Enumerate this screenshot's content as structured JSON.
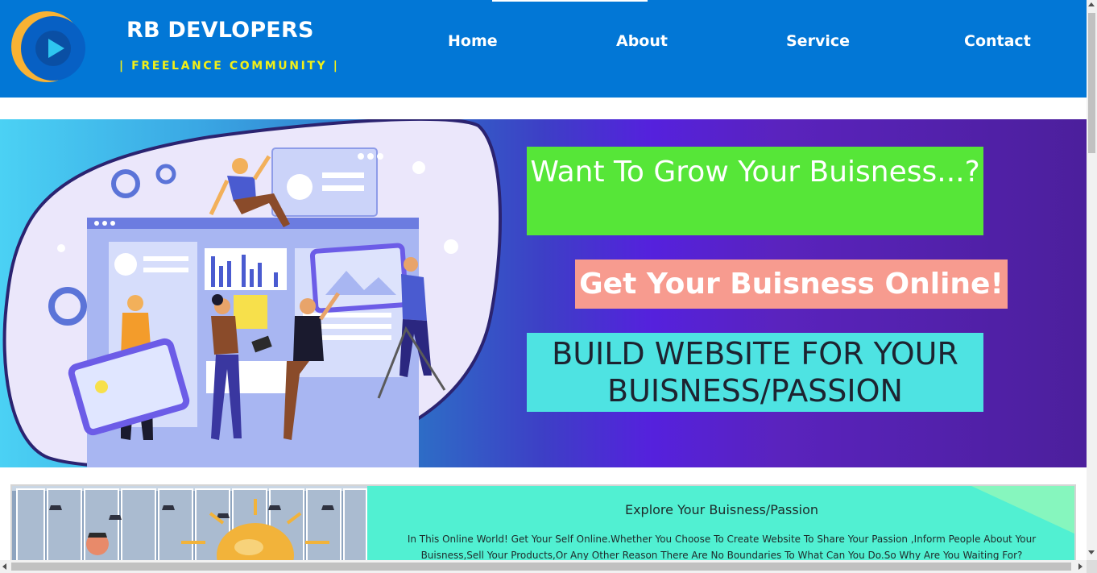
{
  "header": {
    "brand_title": "RB DEVLOPERS",
    "brand_subtitle": "| FREELANCE COMMUNITY |",
    "logo_icon": "play-icon",
    "nav": [
      {
        "label": "Home"
      },
      {
        "label": "About"
      },
      {
        "label": "Service"
      },
      {
        "label": "Contact"
      }
    ],
    "colors": {
      "background": "#0277d6",
      "subtitle": "#f3f016"
    }
  },
  "hero": {
    "illustration": "team-building-website-illustration",
    "headline": "Want To Grow Your Buisness...?",
    "tagline": "Get Your Buisness Online!",
    "callout": "BUILD WEBSITE FOR YOUR BUISNESS/PASSION",
    "colors": {
      "headline_bg": "#56e638",
      "tagline_bg": "#f79b8f",
      "callout_bg": "#4ee3e2"
    }
  },
  "explore": {
    "title": "Explore Your Buisness/Passion",
    "body": "In This Online World! Get Your Self Online.Whether You Choose To Create Website To Share Your Passion ,Inform People About Your Buisness,Sell Your Products,Or Any Other Reason There Are No Boundaries To What Can You Do.So Why Are You Waiting For?",
    "image": "office-lightbulb-idea-illustration",
    "colors": {
      "panel_bg": "#51f0d2"
    }
  }
}
